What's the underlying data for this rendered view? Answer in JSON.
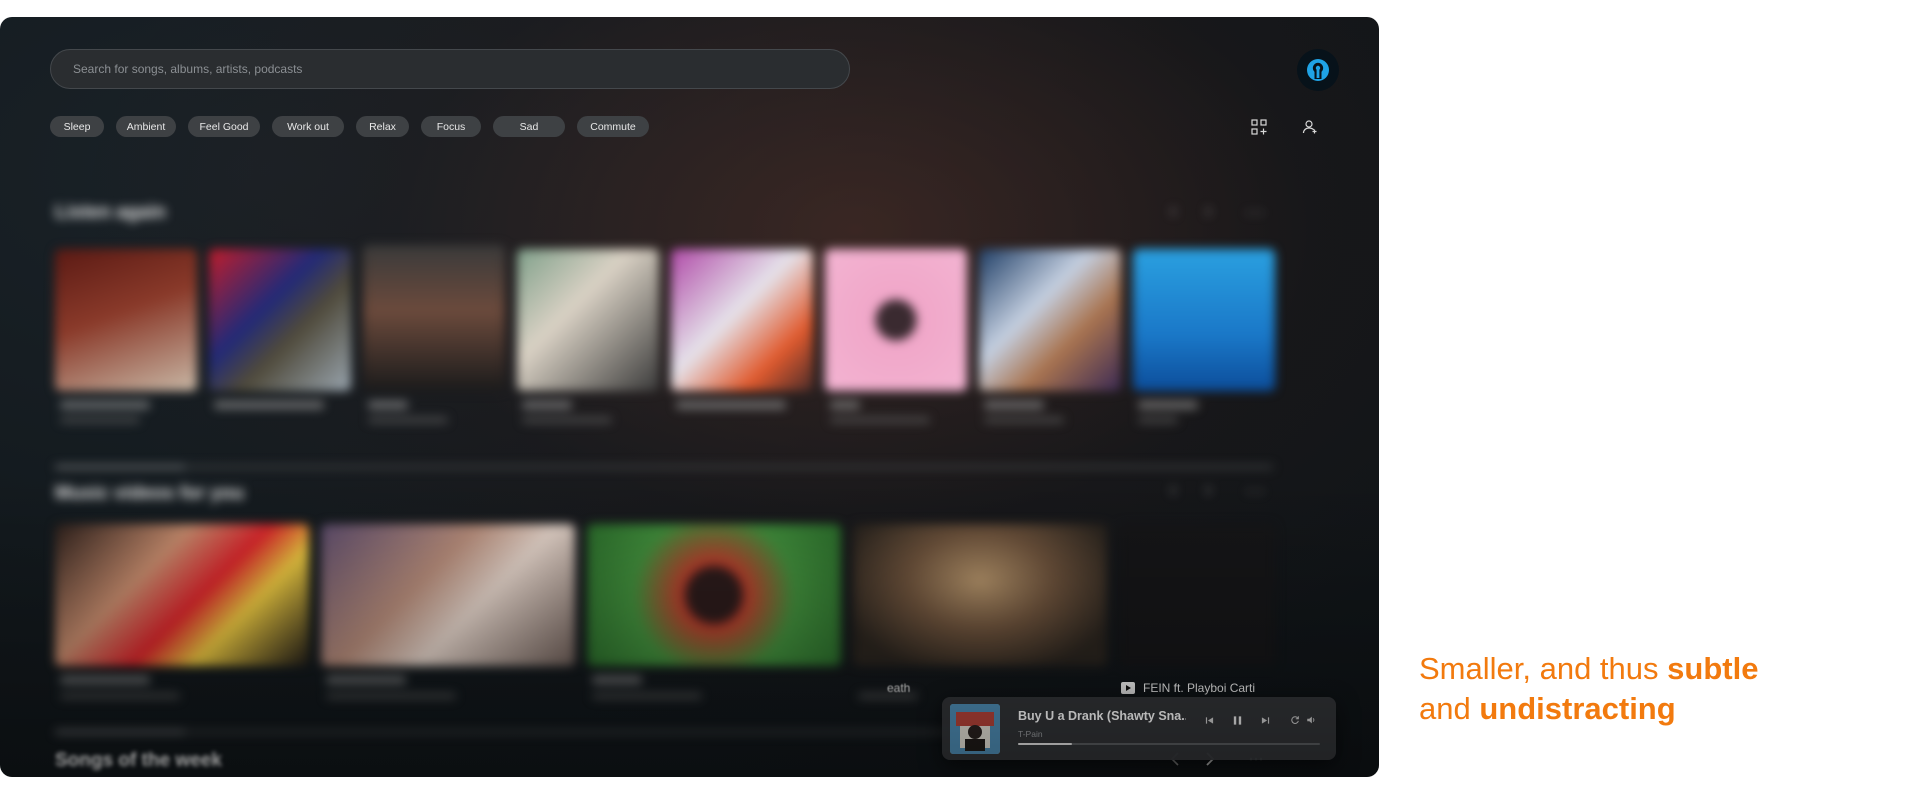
{
  "search": {
    "placeholder": "Search for songs, albums, artists, podcasts"
  },
  "chips": [
    "Sleep",
    "Ambient",
    "Feel Good",
    "Work out",
    "Relax",
    "Focus",
    "Sad",
    "Commute"
  ],
  "sections": {
    "listen_again": "Listen again",
    "music_videos": "Music videos for you",
    "songs_of_week": "Songs of the week"
  },
  "background_text": {
    "behind_player": "eath",
    "next_item": "FEIN ft. Playboi Carti"
  },
  "mini_player": {
    "title": "Buy U a Drank (Shawty Sna...",
    "artist": "T-Pain",
    "progress": 0.18
  },
  "caption": {
    "line1_prefix": "Smaller, and thus ",
    "line1_bold": "subtle",
    "line2_prefix": "and ",
    "line2_bold": "undistracting"
  },
  "icons": {
    "avatar": "user-avatar-icon",
    "header_right_1": "grid-add-icon",
    "header_right_2": "user-add-icon",
    "prev": "chevron-left-icon",
    "next": "chevron-right-icon",
    "more": "more-horizontal-icon",
    "mp_prev": "skip-previous-icon",
    "mp_pause": "pause-icon",
    "mp_next": "skip-next-icon",
    "mp_repeat": "repeat-icon",
    "mp_volume": "volume-icon"
  },
  "colors": {
    "accent_caption": "#f27a0e",
    "app_background": "#12181c",
    "chip_background": "#3e4144",
    "player_background": "#343639"
  }
}
